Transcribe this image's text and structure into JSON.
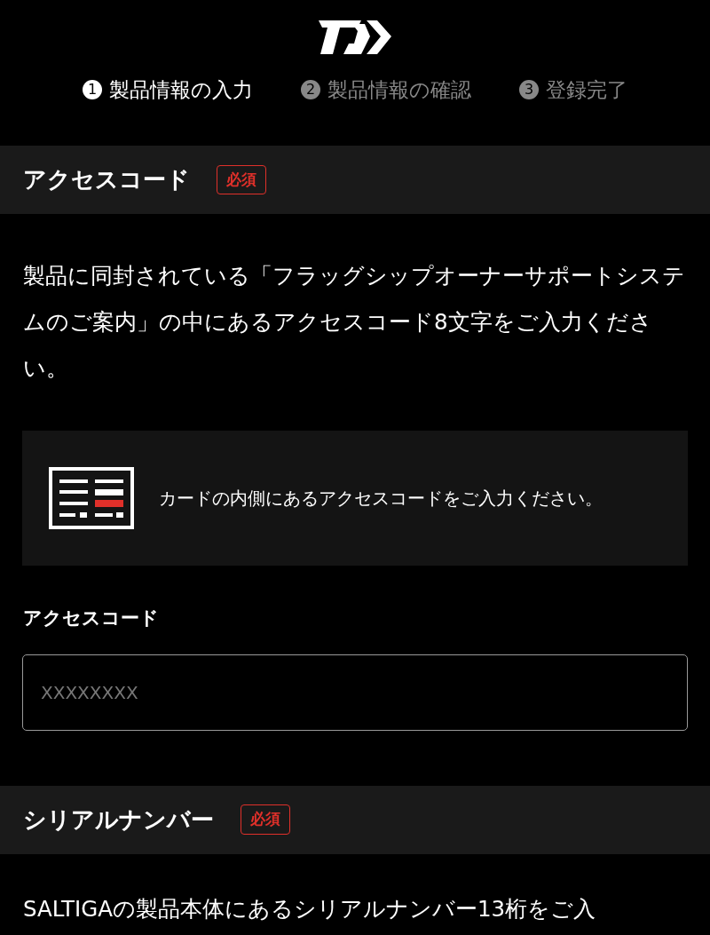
{
  "steps": [
    {
      "number": "1",
      "label": "製品情報の入力",
      "selected": true
    },
    {
      "number": "2",
      "label": "製品情報の確認",
      "selected": false
    },
    {
      "number": "3",
      "label": "登録完了",
      "selected": false
    }
  ],
  "sections": [
    {
      "title": "アクセスコード",
      "badge": "必須",
      "description": "製品に同封されている「フラッグシップオーナーサポートシステムのご案内」の中にあるアクセスコード8文字をご入力ください。",
      "hint": "カードの内側にあるアクセスコードをご入力ください。",
      "field": {
        "label": "アクセスコード",
        "placeholder": "XXXXXXXX"
      }
    },
    {
      "title": "シリアルナンバー",
      "badge": "必須",
      "description": "SALTIGAの製品本体にあるシリアルナンバー13桁をご入"
    }
  ]
}
